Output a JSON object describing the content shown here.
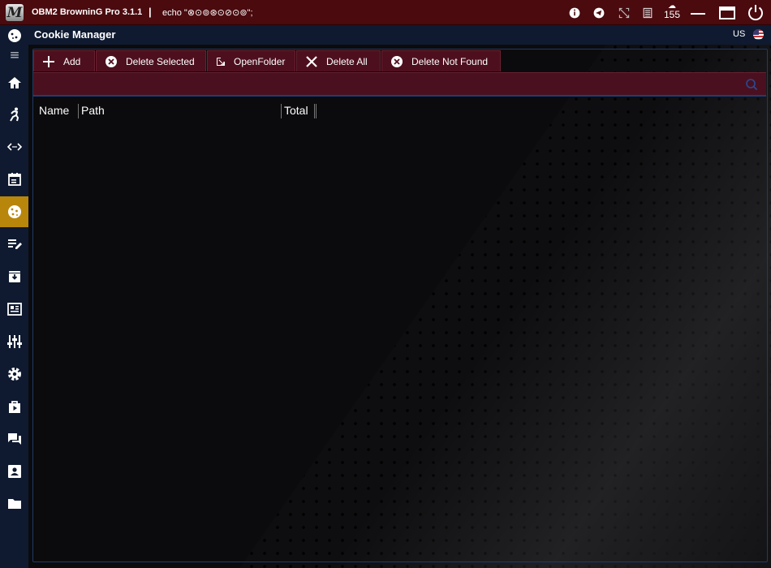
{
  "titlebar": {
    "app_title": "OBM2 BrowninG Pro  3.1.1",
    "separator": "|",
    "echo_text": "echo \"⊗⊙⊚⊛⊙⊘⊙⊚\";",
    "counter": "155",
    "icons": [
      "info-icon",
      "telegram-icon",
      "fullscreen-icon",
      "notes-icon",
      "cloud-icon",
      "minimize-icon",
      "maximize-icon",
      "power-icon"
    ]
  },
  "header": {
    "page_title": "Cookie Manager",
    "language": "US"
  },
  "sidebar": {
    "active": "cookie",
    "items": [
      "cookie-logo",
      "menu",
      "home",
      "automation",
      "api",
      "schedule",
      "cookie",
      "editor",
      "archive",
      "dashboard",
      "mixer",
      "settings",
      "store",
      "chat",
      "contacts",
      "folder"
    ]
  },
  "toolbar": {
    "add_label": "Add",
    "delete_selected_label": "Delete Selected",
    "open_folder_label": "OpenFolder",
    "delete_all_label": "Delete All",
    "delete_not_found_label": "Delete Not Found"
  },
  "search": {
    "value": "",
    "placeholder": ""
  },
  "table": {
    "columns": [
      "Name",
      "Path",
      "Total"
    ],
    "rows": []
  },
  "colors": {
    "titlebar": "#4a0a0e",
    "sidebar": "#0f1a30",
    "active_item": "#b8860b",
    "toolbar_button": "#4d0f1e",
    "accent_blue": "#1e3d78"
  }
}
